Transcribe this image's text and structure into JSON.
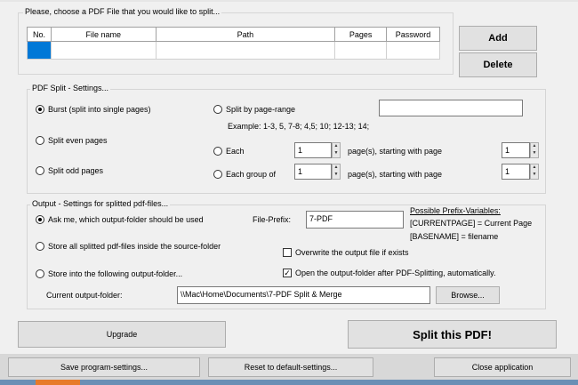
{
  "file_group": {
    "title": "Please, choose a PDF File that you would like to split...",
    "columns": [
      "No.",
      "File name",
      "Path",
      "Pages",
      "Password"
    ],
    "add_label": "Add",
    "delete_label": "Delete"
  },
  "split_settings": {
    "title": "PDF Split - Settings...",
    "burst_label": "Burst (split into single pages)",
    "even_label": "Split even pages",
    "odd_label": "Split odd pages",
    "range_label": "Split by page-range",
    "range_example": "Example: 1-3, 5, 7-8; 4,5; 10; 12-13; 14;",
    "each_label": "Each",
    "each_value": "1",
    "each_suffix": "page(s), starting with page",
    "each_start": "1",
    "group_label": "Each group of",
    "group_value": "1",
    "group_suffix": "page(s), starting with page",
    "group_start": "1",
    "selected": "burst"
  },
  "output_settings": {
    "title": "Output - Settings for splitted pdf-files...",
    "ask_label": "Ask me, which output-folder should be used",
    "store_source_label": "Store all splitted pdf-files inside the source-folder",
    "store_folder_label": "Store into the following output-folder...",
    "prefix_label": "File-Prefix:",
    "prefix_value": "7-PDF",
    "vars_title": "Possible Prefix-Variables:",
    "var1": "[CURRENTPAGE] = Current Page",
    "var2": "[BASENAME] = filename",
    "overwrite_label": "Overwrite the output file if exists",
    "overwrite_checked": false,
    "open_label": "Open the output-folder after PDF-Splitting, automatically.",
    "open_checked": true,
    "current_label": "Current output-folder:",
    "current_value": "\\\\Mac\\Home\\Documents\\7-PDF Split & Merge",
    "browse_label": "Browse...",
    "selected": "ask"
  },
  "actions": {
    "upgrade_label": "Upgrade",
    "split_label": "Split this PDF!"
  },
  "footer": {
    "save_label": "Save program-settings...",
    "reset_label": "Reset to default-settings...",
    "close_label": "Close application"
  },
  "colors": {
    "selection": "#0078d7",
    "taskbar": "#6a8fb5",
    "taskbar_accent": "#e77a2a"
  }
}
